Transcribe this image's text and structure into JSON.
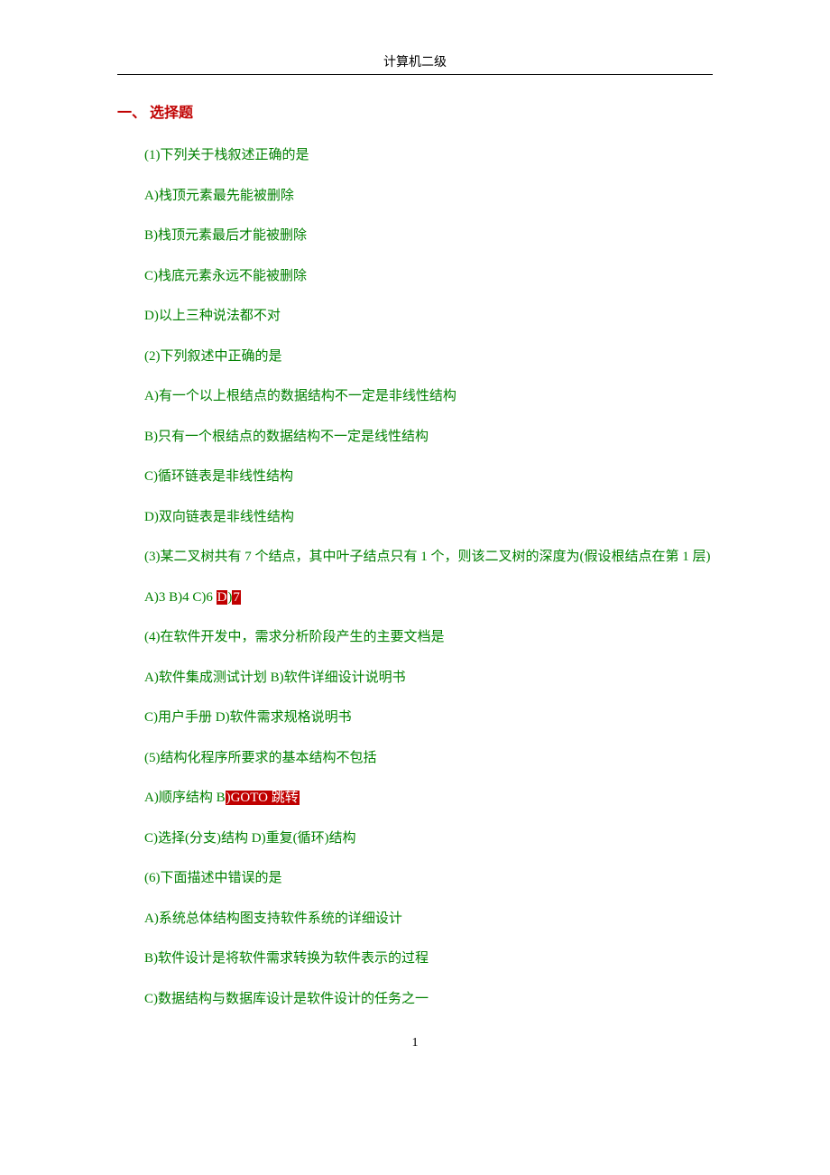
{
  "header": {
    "title": "计算机二级"
  },
  "section": {
    "heading": "一、 选择题"
  },
  "q1": {
    "stem": "(1)下列关于栈叙述正确的是",
    "a": "A)栈顶元素最先能被删除",
    "b": "B)栈顶元素最后才能被删除",
    "c": "C)栈底元素永远不能被删除",
    "d": "D)以上三种说法都不对"
  },
  "q2": {
    "stem": "(2)下列叙述中正确的是",
    "a": "A)有一个以上根结点的数据结构不一定是非线性结构",
    "b": "B)只有一个根结点的数据结构不一定是线性结构",
    "c": "C)循环链表是非线性结构",
    "d": "D)双向链表是非线性结构"
  },
  "q3": {
    "stem": "(3)某二叉树共有 7 个结点，其中叶子结点只有 1 个，则该二叉树的深度为(假设根结点在第 1 层)",
    "opts_prefix": "A)3 B)4 C)6 ",
    "hl1": "D",
    "mid": ")",
    "hl2": "7"
  },
  "q4": {
    "stem": "(4)在软件开发中，需求分析阶段产生的主要文档是",
    "line1": "A)软件集成测试计划  B)软件详细设计说明书",
    "line2": "C)用户手册  D)软件需求规格说明书"
  },
  "q5": {
    "stem": "(5)结构化程序所要求的基本结构不包括",
    "line1_prefix": "A)顺序结构  B",
    "hl": ")GOTO 跳转",
    "line2": "C)选择(分支)结构  D)重复(循环)结构"
  },
  "q6": {
    "stem": "(6)下面描述中错误的是",
    "a": "A)系统总体结构图支持软件系统的详细设计",
    "b": "B)软件设计是将软件需求转换为软件表示的过程",
    "c": "C)数据结构与数据库设计是软件设计的任务之一"
  },
  "footer": {
    "pagenum": "1"
  }
}
